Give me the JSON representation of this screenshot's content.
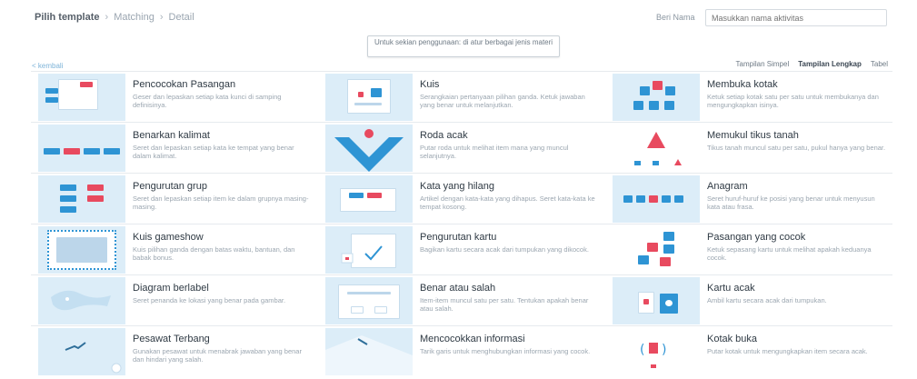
{
  "header": {
    "breadcrumb": [
      "Pilih template",
      "Matching",
      "Detail"
    ],
    "title_label": "Beri Nama",
    "title_placeholder": "Masukkan nama aktivitas"
  },
  "tooltip": "Untuk sekian penggunaan: di atur berbagai jenis materi",
  "back_link": "< kembali",
  "view_options": [
    "Tampilan Simpel",
    "Tampilan Lengkap",
    "Tabel"
  ],
  "templates": [
    {
      "title": "Pencocokan Pasangan",
      "desc": "Geser dan lepaskan setiap kata kunci di samping definisinya.",
      "icon": "match-up-icon"
    },
    {
      "title": "Kuis",
      "desc": "Serangkaian pertanyaan pilihan ganda. Ketuk jawaban yang benar untuk melanjutkan.",
      "icon": "quiz-icon"
    },
    {
      "title": "Membuka kotak",
      "desc": "Ketuk setiap kotak satu per satu untuk membukanya dan mengungkapkan isinya.",
      "icon": "open-box-icon"
    },
    {
      "title": "Benarkan kalimat",
      "desc": "Seret dan lepaskan setiap kata ke tempat yang benar dalam kalimat.",
      "icon": "sentence-icon"
    },
    {
      "title": "Roda acak",
      "desc": "Putar roda untuk melihat item mana yang muncul selanjutnya.",
      "icon": "wheel-icon"
    },
    {
      "title": "Memukul tikus tanah",
      "desc": "Tikus tanah muncul satu per satu, pukul hanya yang benar.",
      "icon": "whack-icon"
    },
    {
      "title": "Pengurutan grup",
      "desc": "Seret dan lepaskan setiap item ke dalam grupnya masing-masing.",
      "icon": "group-sort-icon"
    },
    {
      "title": "Kata yang hilang",
      "desc": "Artikel dengan kata-kata yang dihapus. Seret kata-kata ke tempat kosong.",
      "icon": "missing-word-icon"
    },
    {
      "title": "Anagram",
      "desc": "Seret huruf-huruf ke posisi yang benar untuk menyusun kata atau frasa.",
      "icon": "anagram-icon"
    },
    {
      "title": "Kuis gameshow",
      "desc": "Kuis pilihan ganda dengan batas waktu, bantuan, dan babak bonus.",
      "icon": "gameshow-icon"
    },
    {
      "title": "Pengurutan kartu",
      "desc": "Bagikan kartu secara acak dari tumpukan yang dikocok.",
      "icon": "cards-icon"
    },
    {
      "title": "Pasangan yang cocok",
      "desc": "Ketuk sepasang kartu untuk melihat apakah keduanya cocok.",
      "icon": "matching-pairs-icon"
    },
    {
      "title": "Diagram berlabel",
      "desc": "Seret penanda ke lokasi yang benar pada gambar.",
      "icon": "diagram-icon"
    },
    {
      "title": "Benar atau salah",
      "desc": "Item-item muncul satu per satu. Tentukan apakah benar atau salah.",
      "icon": "true-false-icon"
    },
    {
      "title": "Kartu acak",
      "desc": "Ambil kartu secara acak dari tumpukan.",
      "icon": "random-card-icon"
    },
    {
      "title": "Pesawat Terbang",
      "desc": "Gunakan pesawat untuk menabrak jawaban yang benar dan hindari yang salah.",
      "icon": "airplane-icon"
    },
    {
      "title": "Mencocokkan informasi",
      "desc": "Tarik garis untuk menghubungkan informasi yang cocok.",
      "icon": "info-match-icon"
    },
    {
      "title": "Kotak buka",
      "desc": "Putar kotak untuk mengungkapkan item secara acak.",
      "icon": "spin-box-icon"
    }
  ]
}
